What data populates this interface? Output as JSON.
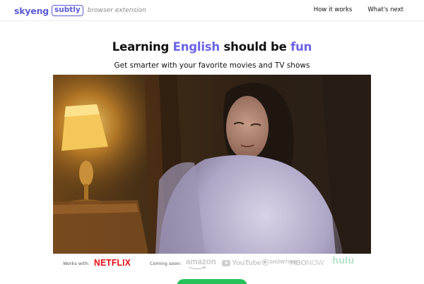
{
  "header": {
    "logo": {
      "brand": "skyeng",
      "product": "subtly",
      "tagline": "browser extension"
    },
    "nav": [
      {
        "label": "How it works"
      },
      {
        "label": "What's next"
      }
    ]
  },
  "hero": {
    "title_start": "Learning ",
    "title_accent": "English",
    "title_middle": " should be ",
    "title_end": "fun",
    "subtitle": "Get smarter with your favorite movies and TV shows"
  },
  "partners": {
    "works_with_label": "Works with:",
    "works_with": "NETFLIX",
    "coming_soon_label": "Coming soon:",
    "coming_soon": {
      "amazon": "amazon",
      "youtube": "YouTube",
      "showtime": "SHOWTIME",
      "hbo": "HBO",
      "now": "NOW",
      "hulu": "hulu"
    }
  },
  "colors": {
    "brand": "#5b5bd6",
    "accent": "#6b63e6",
    "netflix": "#e50914",
    "cta": "#27c35a"
  }
}
